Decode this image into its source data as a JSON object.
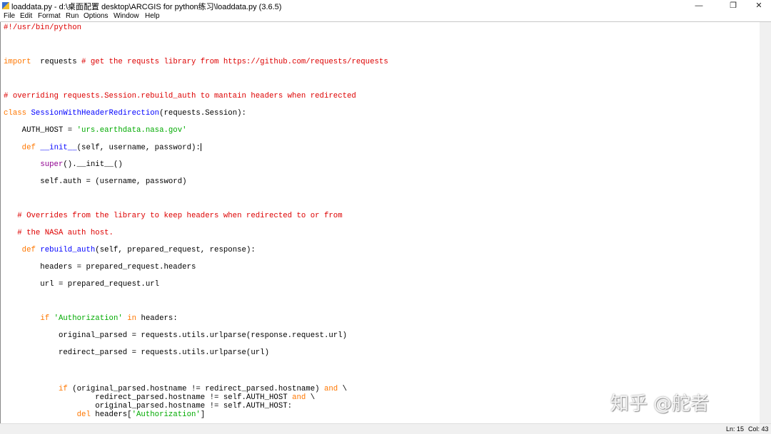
{
  "window": {
    "title": "loaddata.py - d:\\桌面配置 desktop\\ARCGIS for python练习\\loaddata.py (3.6.5)",
    "minimize": "—",
    "maximize": "❐",
    "close": "✕"
  },
  "menu": [
    "File",
    "Edit",
    "Format",
    "Run",
    "Options",
    "Window",
    "Help"
  ],
  "colors": {
    "keyword": "#ff7700",
    "comment": "#dd0000",
    "string": "#00aa00",
    "definition": "#0000ff",
    "builtin": "#900090"
  },
  "code": [
    {
      "row": 0,
      "tokens": [
        [
          "cm",
          "#!/usr/bin/python"
        ]
      ]
    },
    {
      "row": 2,
      "tokens": [
        [
          "kw",
          "import"
        ],
        [
          "",
          "  requests "
        ],
        [
          "cm",
          "# get the requsts library from https://github.com/requests/requests"
        ]
      ]
    },
    {
      "row": 4,
      "tokens": [
        [
          "cm",
          "# overriding requests.Session.rebuild_auth to mantain headers when redirected"
        ]
      ]
    },
    {
      "row": 5,
      "tokens": [
        [
          "kw",
          "class"
        ],
        [
          "",
          " "
        ],
        [
          "fn",
          "SessionWithHeaderRedirection"
        ],
        [
          "",
          "(requests.Session):"
        ]
      ]
    },
    {
      "row": 6,
      "tokens": [
        [
          "",
          "    AUTH_HOST = "
        ],
        [
          "st",
          "'urs.earthdata.nasa.gov'"
        ]
      ]
    },
    {
      "row": 7,
      "tokens": [
        [
          "",
          "    "
        ],
        [
          "kw",
          "def"
        ],
        [
          "",
          " "
        ],
        [
          "fn",
          "__init__"
        ],
        [
          "",
          "(self, username, password):"
        ]
      ],
      "caret": true
    },
    {
      "row": 8,
      "tokens": [
        [
          "",
          "        "
        ],
        [
          "bi",
          "super"
        ],
        [
          "",
          "().__init__()"
        ]
      ]
    },
    {
      "row": 9,
      "tokens": [
        [
          "",
          "        self.auth = (username, password)"
        ]
      ]
    },
    {
      "row": 11,
      "tokens": [
        [
          "",
          "   "
        ],
        [
          "cm",
          "# Overrides from the library to keep headers when redirected to or from"
        ]
      ]
    },
    {
      "row": 12,
      "tokens": [
        [
          "",
          "   "
        ],
        [
          "cm",
          "# the NASA auth host."
        ]
      ]
    },
    {
      "row": 13,
      "tokens": [
        [
          "",
          "    "
        ],
        [
          "kw",
          "def"
        ],
        [
          "",
          " "
        ],
        [
          "fn",
          "rebuild_auth"
        ],
        [
          "",
          "(self, prepared_request, response):"
        ]
      ]
    },
    {
      "row": 14,
      "tokens": [
        [
          "",
          "        headers = prepared_request.headers"
        ]
      ]
    },
    {
      "row": 15,
      "tokens": [
        [
          "",
          "        url = prepared_request.url"
        ]
      ]
    },
    {
      "row": 17,
      "tokens": [
        [
          "",
          "        "
        ],
        [
          "kw",
          "if"
        ],
        [
          "",
          " "
        ],
        [
          "st",
          "'Authorization'"
        ],
        [
          "",
          " "
        ],
        [
          "kw",
          "in"
        ],
        [
          "",
          " headers:"
        ]
      ]
    },
    {
      "row": 18,
      "tokens": [
        [
          "",
          "            original_parsed = requests.utils.urlparse(response.request.url)"
        ]
      ]
    },
    {
      "row": 19,
      "tokens": [
        [
          "",
          "            redirect_parsed = requests.utils.urlparse(url)"
        ]
      ]
    },
    {
      "row": 21,
      "tokens": [
        [
          "",
          "            "
        ],
        [
          "kw",
          "if"
        ],
        [
          "",
          " (original_parsed.hostname != redirect_parsed.hostname) "
        ],
        [
          "kw",
          "and"
        ],
        [
          "",
          " \\"
        ]
      ]
    },
    {
      "row": 22,
      "tokens": [
        [
          "",
          "                    redirect_parsed.hostname != self.AUTH_HOST "
        ],
        [
          "kw",
          "and"
        ],
        [
          "",
          " \\"
        ]
      ]
    },
    {
      "row": 23,
      "tokens": [
        [
          "",
          "                    original_parsed.hostname != self.AUTH_HOST:"
        ]
      ]
    },
    {
      "row": 24,
      "tokens": [
        [
          "",
          "                "
        ],
        [
          "kw",
          "del"
        ],
        [
          "",
          " headers["
        ],
        [
          "st",
          "'Authorization'"
        ],
        [
          "",
          "]"
        ]
      ]
    }
  ],
  "status": {
    "line": "Ln: 15",
    "col": "Col: 43"
  },
  "watermark": "知乎 @舵者"
}
